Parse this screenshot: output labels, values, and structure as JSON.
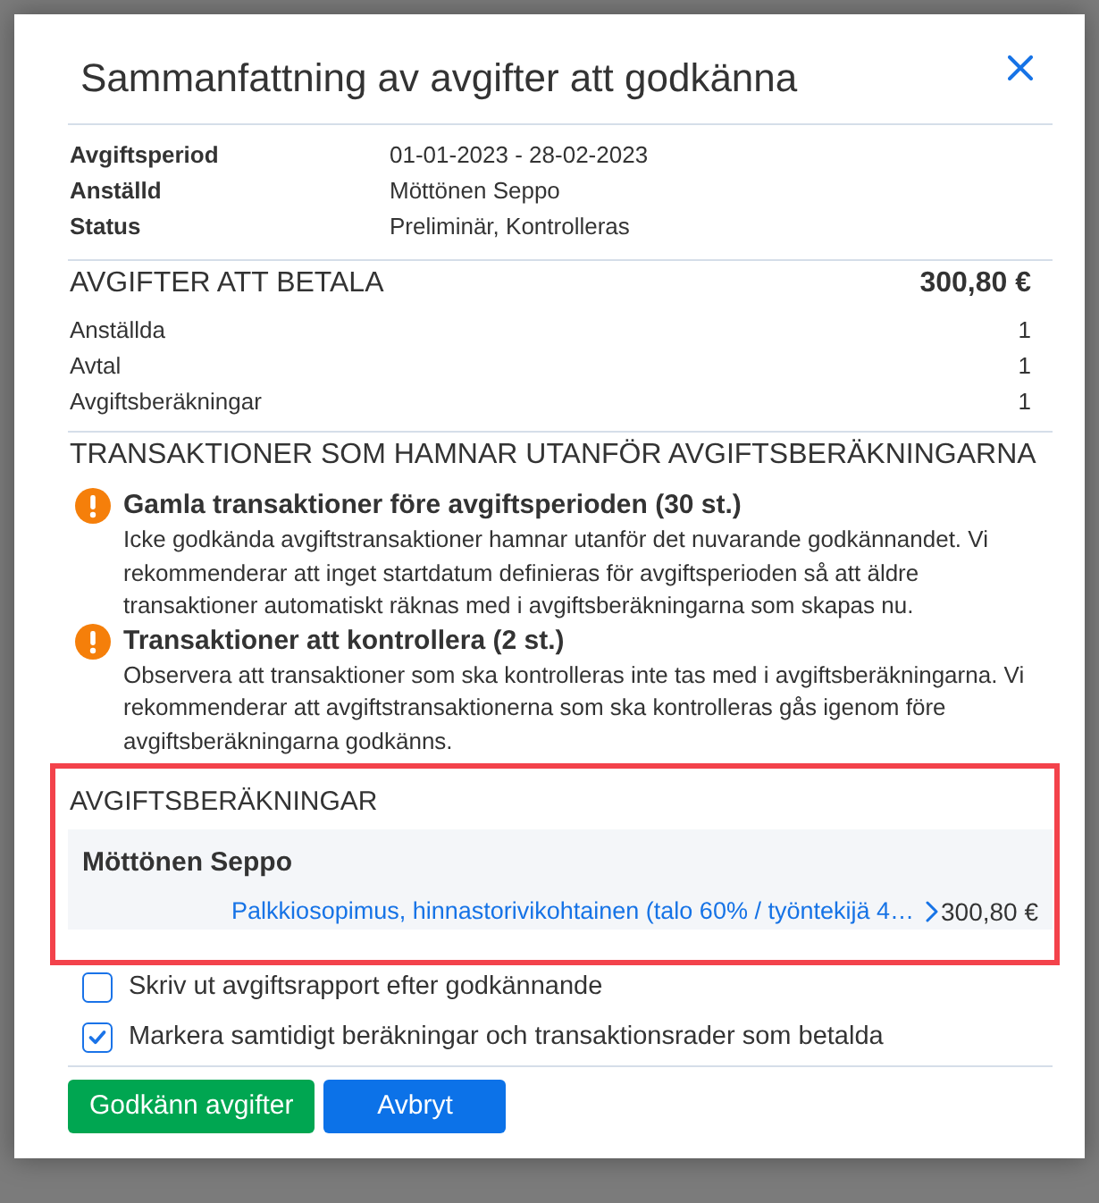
{
  "dialog": {
    "title": "Sammanfattning av avgifter att godkänna"
  },
  "details": [
    {
      "label": "Avgiftsperiod",
      "value": "01-01-2023 - 28-02-2023"
    },
    {
      "label": "Anställd",
      "value": "Möttönen Seppo"
    },
    {
      "label": "Status",
      "value": "Preliminär, Kontrolleras"
    }
  ],
  "fees": {
    "heading": "AVGIFTER ATT BETALA",
    "total": "300,80 €",
    "rows": [
      {
        "label": "Anställda",
        "value": "1"
      },
      {
        "label": "Avtal",
        "value": "1"
      },
      {
        "label": "Avgiftsberäkningar",
        "value": "1"
      }
    ]
  },
  "excluded_transactions": {
    "heading": "TRANSAKTIONER SOM HAMNAR UTANFÖR AVGIFTSBERÄKNINGARNA",
    "warnings": [
      {
        "title": "Gamla transaktioner före avgiftsperioden (30 st.)",
        "text": "Icke godkända avgiftstransaktioner hamnar utanför det nuvarande godkännandet. Vi rekommenderar att inget startdatum definieras för avgiftsperioden så att äldre transaktioner automatiskt räknas med i avgiftsberäkningarna som skapas nu."
      },
      {
        "title": "Transaktioner att kontrollera (2 st.)",
        "text": "Observera att transaktioner som ska kontrolleras inte tas med i avgiftsberäkningarna. Vi rekommenderar att avgiftstransaktionerna som ska kontrolleras gås igenom före avgiftsberäkningarna godkänns."
      }
    ]
  },
  "calculations": {
    "heading": "AVGIFTSBERÄKNINGAR",
    "highlighted": true,
    "employees": [
      {
        "name": "Möttönen Seppo",
        "lines": [
          {
            "contract": "Palkkiosopimus, hinnastorivikohtainen (talo 60% / työntekijä 4…",
            "amount": "300,80 €"
          }
        ]
      }
    ]
  },
  "options": [
    {
      "label": "Skriv ut avgiftsrapport efter godkännande",
      "checked": false
    },
    {
      "label": "Markera samtidigt beräkningar och transaktionsrader som betalda",
      "checked": true
    }
  ],
  "buttons": [
    {
      "label": "Godkänn avgifter",
      "kind": "confirm"
    },
    {
      "label": "Avbryt",
      "kind": "cancel"
    }
  ]
}
